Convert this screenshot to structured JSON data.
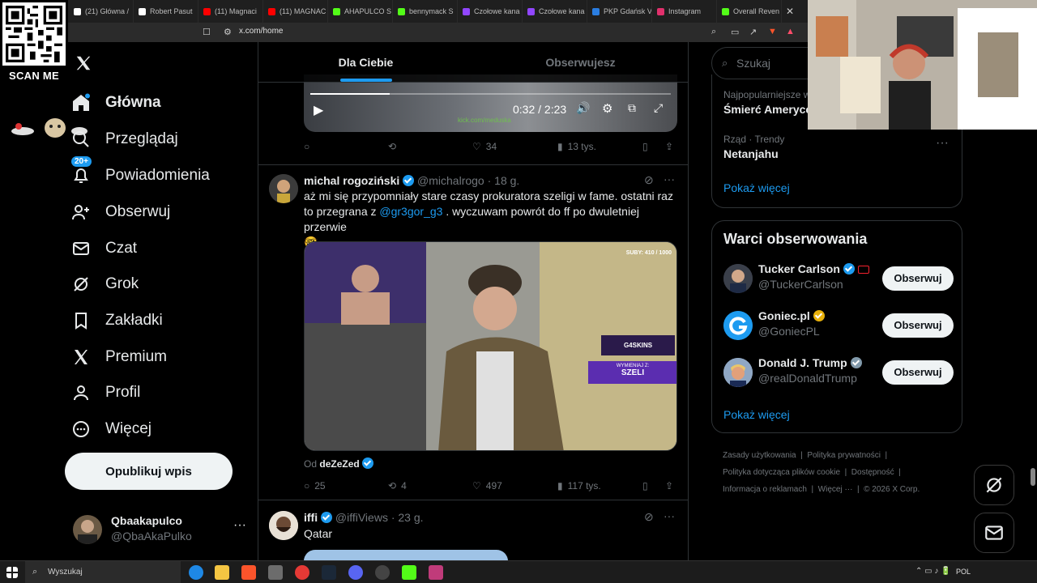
{
  "qr": {
    "label": "SCAN ME"
  },
  "browser": {
    "tabs": [
      {
        "title": "(21) Główna /",
        "icon": "x-icon",
        "color": "#ffffff"
      },
      {
        "title": "Robert Pasut",
        "icon": "tiktok-icon",
        "color": "#ffffff"
      },
      {
        "title": "(11) Magnaci",
        "icon": "youtube-icon",
        "color": "#ff0000"
      },
      {
        "title": "(11) MAGNAC",
        "icon": "youtube-icon",
        "color": "#ff0000"
      },
      {
        "title": "AHAPULCO S",
        "icon": "kick-icon",
        "color": "#53fc18"
      },
      {
        "title": "bennymack S",
        "icon": "kick-icon",
        "color": "#53fc18"
      },
      {
        "title": "Czołowe kana",
        "icon": "twitch-icon",
        "color": "#9146ff"
      },
      {
        "title": "Czołowe kana",
        "icon": "twitch-icon",
        "color": "#9146ff"
      },
      {
        "title": "PKP Gdańsk V",
        "icon": "page-icon",
        "color": "#2a7de1"
      },
      {
        "title": "Instagram",
        "icon": "instagram-icon",
        "color": "#e1306c"
      },
      {
        "title": "Overall Reven",
        "icon": "kick-icon",
        "color": "#53fc18"
      }
    ],
    "url": "x.com/home"
  },
  "nav": {
    "items": [
      {
        "label": "Główna",
        "icon": "home-icon"
      },
      {
        "label": "Przeglądaj",
        "icon": "search-icon"
      },
      {
        "label": "Powiadomienia",
        "icon": "bell-icon",
        "badge": "20+"
      },
      {
        "label": "Obserwuj",
        "icon": "person-plus-icon"
      },
      {
        "label": "Czat",
        "icon": "mail-icon"
      },
      {
        "label": "Grok",
        "icon": "grok-icon"
      },
      {
        "label": "Zakładki",
        "icon": "bookmark-icon"
      },
      {
        "label": "Premium",
        "icon": "x-icon"
      },
      {
        "label": "Profil",
        "icon": "person-icon"
      },
      {
        "label": "Więcej",
        "icon": "more-circle-icon"
      }
    ],
    "publish_label": "Opublikuj wpis",
    "account": {
      "name": "Qbaakapulco",
      "handle": "@QbaAkaPulko"
    }
  },
  "feed": {
    "tabs": [
      {
        "label": "Dla Ciebie",
        "active": true
      },
      {
        "label": "Obserwujesz",
        "active": false
      }
    ],
    "video_post": {
      "time": "0:32 / 2:23",
      "progress": 0.22,
      "watermark": "kick.com/meduska",
      "stats": {
        "replies": "",
        "reposts": "",
        "likes": "34",
        "views": "13 tys."
      }
    },
    "post1": {
      "name": "michal rogoziński",
      "handle": "@michalrogo",
      "time": "· 18 g.",
      "text_before": "aż mi się przypomniały stare czasy prokuratora szeligi w fame. ostatni raz to przegrana z ",
      "mention": "@gr3gor_g3",
      "text_after": " . wyczuwam powrót do ff po dwuletniej przerwie",
      "emoji": "🤓",
      "media_overlay": {
        "subs": "SUBY: 410 / 1000",
        "sponsor": "G4SKINS",
        "banner_top": "WYMIENIAJ Z:",
        "banner_bottom": "SZELI"
      },
      "from_label": "Od",
      "from_name": "deZeZed",
      "stats": {
        "replies": "25",
        "reposts": "4",
        "likes": "497",
        "views": "117 tys."
      }
    },
    "post2": {
      "name": "iffi",
      "handle": "@iffiViews",
      "time": "· 23 g.",
      "text": "Qatar"
    }
  },
  "right": {
    "search_placeholder": "Szukaj",
    "trends": [
      {
        "context": "Najpopularniejsze w",
        "title": "Śmierć Ameryce"
      },
      {
        "context": "Rząd · Trendy",
        "title": "Netanjahu"
      }
    ],
    "show_more": "Pokaż więcej",
    "who_to_follow": {
      "title": "Warci obserwowania",
      "accounts": [
        {
          "name": "Tucker Carlson",
          "handle": "@TuckerCarlson",
          "button": "Obserwuj"
        },
        {
          "name": "Goniec.pl",
          "handle": "@GoniecPL",
          "button": "Obserwuj"
        },
        {
          "name": "Donald J. Trump",
          "handle": "@realDonaldTrump",
          "button": "Obserwuj"
        }
      ],
      "show_more": "Pokaż więcej"
    },
    "footer": {
      "links": [
        "Zasady użytkowania",
        "Polityka prywatności",
        "Polityka dotycząca plików cookie",
        "Dostępność",
        "Informacja o reklamach",
        "Więcej ···"
      ],
      "copyright": "© 2026 X Corp."
    }
  },
  "taskbar": {
    "search": "Wyszukaj",
    "lang": "POL"
  }
}
